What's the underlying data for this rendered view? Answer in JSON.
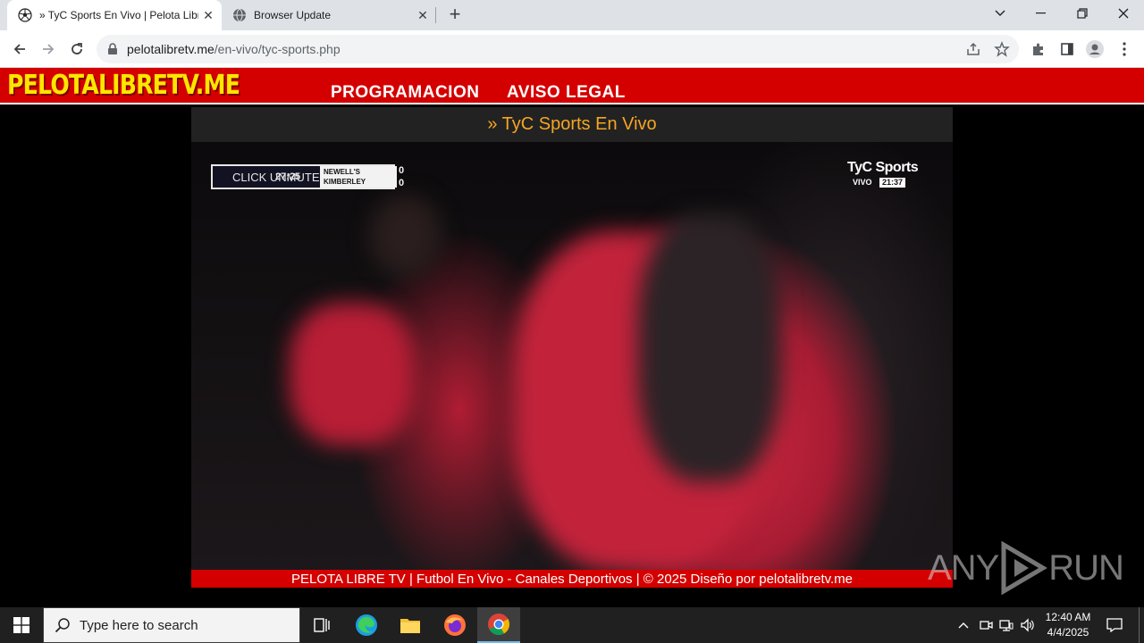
{
  "browser": {
    "tabs": [
      {
        "title": "» TyC Sports En Vivo | Pelota Libre",
        "icon": "soccer-ball-icon",
        "active": true
      },
      {
        "title": "Browser Update",
        "icon": "globe-icon",
        "active": false
      }
    ],
    "url_host": "pelotalibretv.me",
    "url_path": "/en-vivo/tyc-sports.php"
  },
  "site": {
    "logo": "PELOTALIBRETV.ME",
    "nav": [
      "PROGRAMACION",
      "AVISO LEGAL"
    ],
    "page_title": "» TyC Sports En Vivo",
    "footer": "PELOTA LIBRE TV | Futbol En Vivo - Canales Deportivos | © 2025 Diseño por pelotalibretv.me"
  },
  "player": {
    "overlay_label": "CLICK UNMUTE",
    "overlay_time": "27:25",
    "home_team": "NEWELL'S",
    "away_team": "KIMBERLEY",
    "home_score": "0",
    "away_score": "0",
    "channel": "TyC Sports",
    "channel_tag": "VIVO",
    "channel_clock": "21:37"
  },
  "watermark": "RUN",
  "watermark_prefix": "ANY",
  "taskbar": {
    "search_placeholder": "Type here to search",
    "time": "12:40 AM",
    "date": "4/4/2025"
  },
  "colors": {
    "site_red": "#d40000",
    "logo_yellow": "#ffe500",
    "title_orange": "#f5a623"
  }
}
